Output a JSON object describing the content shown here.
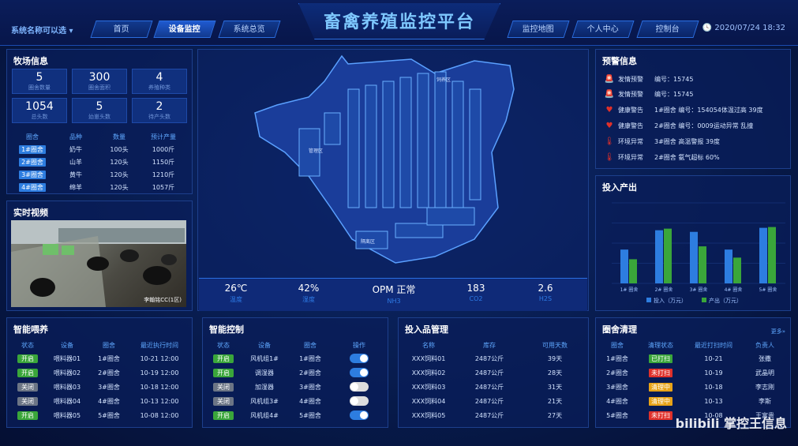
{
  "header": {
    "system_name": "系统名称可以选",
    "title": "畜禽养殖监控平台",
    "date": "2020/07/24  18:32",
    "nav_left": [
      "首页",
      "设备监控",
      "系统总览"
    ],
    "nav_right": [
      "监控地图",
      "个人中心",
      "控制台"
    ]
  },
  "farm": {
    "title": "牧场信息",
    "stats": [
      {
        "value": "5",
        "label": "圈舍数量"
      },
      {
        "value": "300",
        "label": "圈舍面积"
      },
      {
        "value": "4",
        "label": "养殖种类"
      },
      {
        "value": "1054",
        "label": "总头数"
      },
      {
        "value": "5",
        "label": "幼崽头数"
      },
      {
        "value": "2",
        "label": "待产头数"
      }
    ],
    "headers": [
      "圈舍",
      "品种",
      "数量",
      "预计产量"
    ],
    "rows": [
      [
        "1#圈舍",
        "奶牛",
        "100头",
        "1000斤"
      ],
      [
        "2#圈舍",
        "山羊",
        "120头",
        "1150斤"
      ],
      [
        "3#圈舍",
        "黄牛",
        "120头",
        "1210斤"
      ],
      [
        "4#圈舍",
        "绵羊",
        "120头",
        "1057斤"
      ]
    ]
  },
  "video": {
    "title": "实时视频",
    "caption": "李翰铭CC(1区)"
  },
  "env": [
    {
      "value": "26℃",
      "label": "温度"
    },
    {
      "value": "42%",
      "label": "湿度"
    },
    {
      "value": "OPM 正常",
      "label": "NH3"
    },
    {
      "value": "183",
      "label": "CO2"
    },
    {
      "value": "2.6",
      "label": "H2S"
    }
  ],
  "map": {
    "label1": "饲养区",
    "label2": "管理区",
    "label3": "隔离区"
  },
  "alerts": {
    "title": "预警信息",
    "items": [
      {
        "type": "发情预警",
        "text": "编号：15745",
        "icon": "alarm-light-icon"
      },
      {
        "type": "发情预警",
        "text": "编号：15745",
        "icon": "alarm-light-icon"
      },
      {
        "type": "健康警告",
        "text": "1#圈舍    编号：154054体温过高    39度",
        "icon": "heartbeat-icon"
      },
      {
        "type": "健康警告",
        "text": "2#圈舍    编号：0009运动异常    乱撞",
        "icon": "heartbeat-icon"
      },
      {
        "type": "环境异常",
        "text": "3#圈舍    高温警报        39度",
        "icon": "thermometer-icon"
      },
      {
        "type": "环境异常",
        "text": "2#圈舍    氨气超标        60%",
        "icon": "thermometer-icon"
      }
    ]
  },
  "chart_data": {
    "type": "bar",
    "title": "投入产出",
    "categories": [
      "1# 圈舍",
      "2# 圈舍",
      "3# 圈舍",
      "4# 圈舍",
      "5# 圈舍"
    ],
    "series": [
      {
        "name": "投入（万元）",
        "values": [
          42,
          66,
          64,
          42,
          69
        ],
        "color": "#2d7de0"
      },
      {
        "name": "产出（万元）",
        "values": [
          30,
          68,
          46,
          32,
          70
        ],
        "color": "#3aa63a"
      }
    ],
    "ylim": [
      0,
      100
    ],
    "legend": "bottom",
    "grid": true
  },
  "feeding": {
    "title": "智能喂养",
    "headers": [
      "状态",
      "设备",
      "圈舍",
      "最近执行时间"
    ],
    "rows": [
      [
        "开启",
        "喂料器01",
        "1#圈舍",
        "10-21  12:00"
      ],
      [
        "开启",
        "喂料器02",
        "2#圈舍",
        "10-19  12:00"
      ],
      [
        "关闭",
        "喂料器03",
        "3#圈舍",
        "10-18  12:00"
      ],
      [
        "关闭",
        "喂料器04",
        "4#圈舍",
        "10-13  12:00"
      ],
      [
        "开启",
        "喂料器05",
        "5#圈舍",
        "10-08  12:00"
      ]
    ]
  },
  "control": {
    "title": "智能控制",
    "headers": [
      "状态",
      "设备",
      "圈舍",
      "操作"
    ],
    "rows": [
      [
        "开启",
        "风机组1#",
        "1#圈舍",
        true
      ],
      [
        "开启",
        "调湿器",
        "2#圈舍",
        true
      ],
      [
        "关闭",
        "加湿器",
        "3#圈舍",
        false
      ],
      [
        "关闭",
        "风机组3#",
        "4#圈舍",
        false
      ],
      [
        "开启",
        "风机组4#",
        "5#圈舍",
        true
      ]
    ]
  },
  "inputs": {
    "title": "投入品管理",
    "headers": [
      "名称",
      "库存",
      "可用天数"
    ],
    "rows": [
      [
        "XXX饲料01",
        "2487公斤",
        "39天"
      ],
      [
        "XXX饲料02",
        "2487公斤",
        "28天"
      ],
      [
        "XXX饲料03",
        "2487公斤",
        "31天"
      ],
      [
        "XXX饲料04",
        "2487公斤",
        "21天"
      ],
      [
        "XXX饲料05",
        "2487公斤",
        "27天"
      ]
    ]
  },
  "cleaning": {
    "title": "圈舍清理",
    "more": "更多»",
    "headers": [
      "圈舍",
      "清理状态",
      "最近打扫时间",
      "负责人"
    ],
    "rows": [
      [
        "1#圈舍",
        "已打扫",
        "10-21",
        "张撒"
      ],
      [
        "2#圈舍",
        "未打扫",
        "10-19",
        "武晶明"
      ],
      [
        "3#圈舍",
        "清理中",
        "10-18",
        "李志刚"
      ],
      [
        "4#圈舍",
        "清理中",
        "10-13",
        "李斯"
      ],
      [
        "5#圈舍",
        "未打扫",
        "10-08",
        "王富贵"
      ]
    ],
    "colors": {
      "已打扫": "#3aa63a",
      "未打扫": "#e0302a",
      "清理中": "#e8a317"
    }
  },
  "watermark": "bilibili  掌控王信息"
}
